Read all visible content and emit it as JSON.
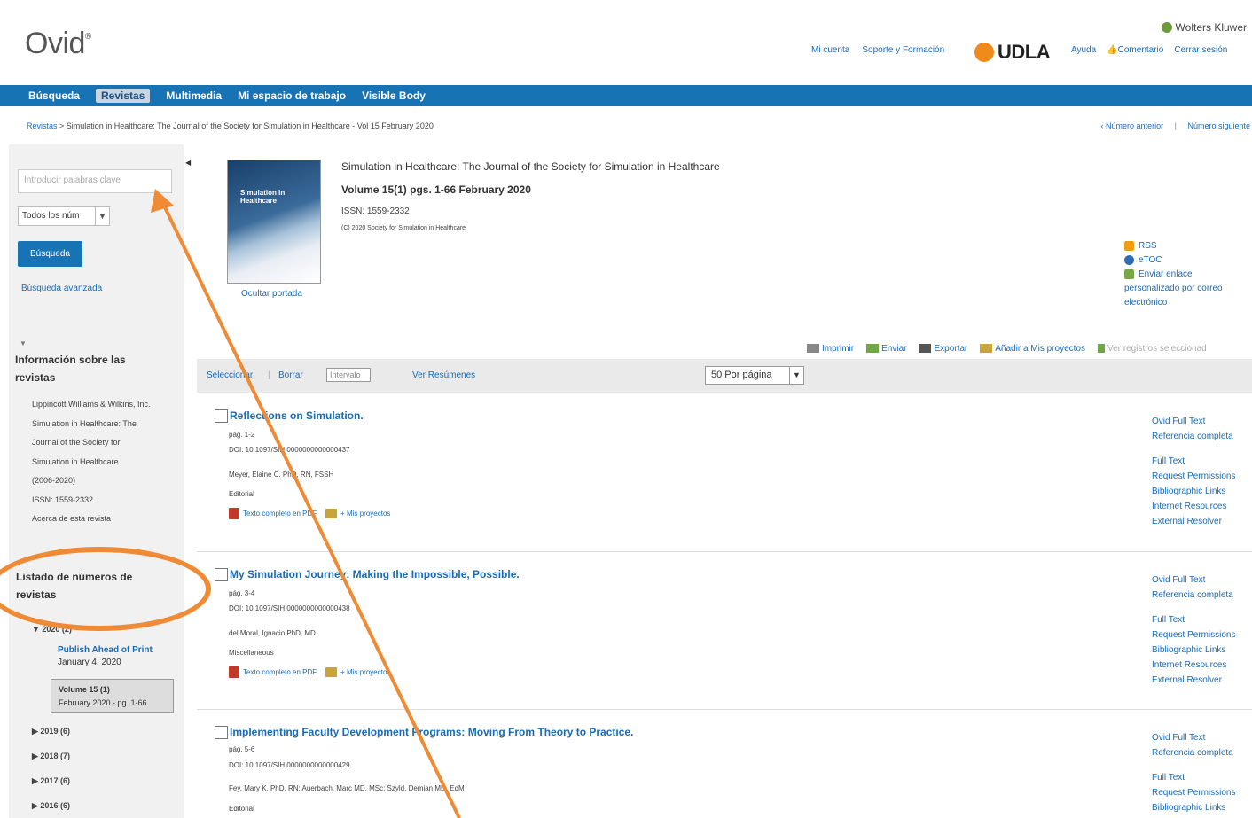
{
  "header": {
    "logo": "Ovid",
    "publisher": "Wolters Kluwer",
    "links_left": [
      "Mi cuenta",
      "Soporte y Formación"
    ],
    "institution": "UDLA",
    "links_right": [
      "Ayuda",
      "Comentario",
      "Cerrar sesión"
    ]
  },
  "nav": {
    "items": [
      "Búsqueda",
      "Revistas",
      "Multimedia",
      "Mi espacio de trabajo",
      "Visible Body"
    ],
    "active": "Revistas"
  },
  "breadcrumb": "Revistas > Simulation in Healthcare: The Journal of the Society for Simulation in Healthcare - Vol 15 February 2020",
  "issue_nav": {
    "prev": "‹ Número anterior",
    "next": "Número siguiente"
  },
  "sidebar": {
    "search_placeholder": "Introducir palabras clave",
    "scope_select": "Todos los núm",
    "search_button": "Búsqueda",
    "advanced_link": "Búsqueda avanzada",
    "info_heading_1": "Información sobre las",
    "info_heading_2": "revistas",
    "publisher_link": "Lippincott Williams & Wilkins, Inc.",
    "journal_lines": [
      "Simulation in Healthcare: The",
      "Journal of the Society for",
      "Simulation in Healthcare",
      "(2006-2020)",
      "ISSN: 1559-2332"
    ],
    "about_link": "Acerca de esta revista",
    "issues_heading_1": "Listado de números de",
    "issues_heading_2": "revistas",
    "year_open": "▼ 2020 (2)",
    "ahead_link": "Publish Ahead of Print",
    "ahead_date": "January 4, 2020",
    "current_vol": "Volume 15 (1)",
    "current_vol_date": "February 2020 - pg. 1-66",
    "years": [
      "▶ 2019 (6)",
      "▶ 2018 (7)",
      "▶ 2017 (6)",
      "▶ 2016 (6)"
    ]
  },
  "journal": {
    "title": "Simulation in Healthcare: The Journal of the Society for Simulation in Healthcare",
    "volume": "Volume 15(1) pgs. 1-66 February 2020",
    "issn": "ISSN: 1559-2332",
    "copyright": "(C) 2020 Society for Simulation in Healthcare",
    "hide_cover": "Ocultar portada",
    "cover_title": "Simulation in Healthcare"
  },
  "right_tools": {
    "rss": "RSS",
    "etoc": "eTOC",
    "send_link_1": "Enviar enlace",
    "send_link_2": "personalizado por correo",
    "send_link_3": "electrónico"
  },
  "toolbar": {
    "print": "Imprimir",
    "send": "Enviar",
    "export": "Exportar",
    "add": "Añadir a Mis proyectos",
    "view_selected": "Ver registros seleccionad"
  },
  "selectbar": {
    "select": "Seleccionar",
    "clear": "Borrar",
    "interval_placeholder": "Intervalo",
    "abstracts": "Ver Resúmenes",
    "per_page": "50  Por página"
  },
  "articles": [
    {
      "title": "Reflections on Simulation.",
      "pages": "pág. 1-2",
      "doi": "DOI: 10.1097/SIH.0000000000000437",
      "authors": "Meyer, Elaine C. PhD, RN, FSSH",
      "type": "Editorial",
      "pdf": "Texto completo en PDF",
      "projects": "+ Mis proyectos",
      "links": [
        "Ovid Full Text",
        "Referencia completa",
        "Full Text",
        "Request Permissions",
        "Bibliographic Links",
        "Internet Resources",
        "External Resolver"
      ]
    },
    {
      "title": "My Simulation Journey: Making the Impossible, Possible.",
      "pages": "pág. 3-4",
      "doi": "DOI: 10.1097/SIH.0000000000000438",
      "authors": "del Moral, Ignacio PhD, MD",
      "type": "Miscellaneous",
      "pdf": "Texto completo en PDF",
      "projects": "+ Mis proyectos",
      "links": [
        "Ovid Full Text",
        "Referencia completa",
        "Full Text",
        "Request Permissions",
        "Bibliographic Links",
        "Internet Resources",
        "External Resolver"
      ]
    },
    {
      "title": "Implementing Faculty Development Programs: Moving From Theory to Practice.",
      "pages": "pág. 5-6",
      "doi": "DOI: 10.1097/SIH.0000000000000429",
      "authors": "Fey, Mary K. PhD, RN; Auerbach, Marc MD, MSc; Szyld, Demian MD, EdM",
      "type": "Editorial",
      "links": [
        "Ovid Full Text",
        "Referencia completa",
        "Full Text",
        "Request Permissions",
        "Bibliographic Links"
      ]
    }
  ],
  "colors": {
    "nav_blue": "#1873b5",
    "link_blue": "#1a6bb5",
    "annotation_orange": "#ef8a35",
    "udla_orange": "#f08a1c"
  }
}
